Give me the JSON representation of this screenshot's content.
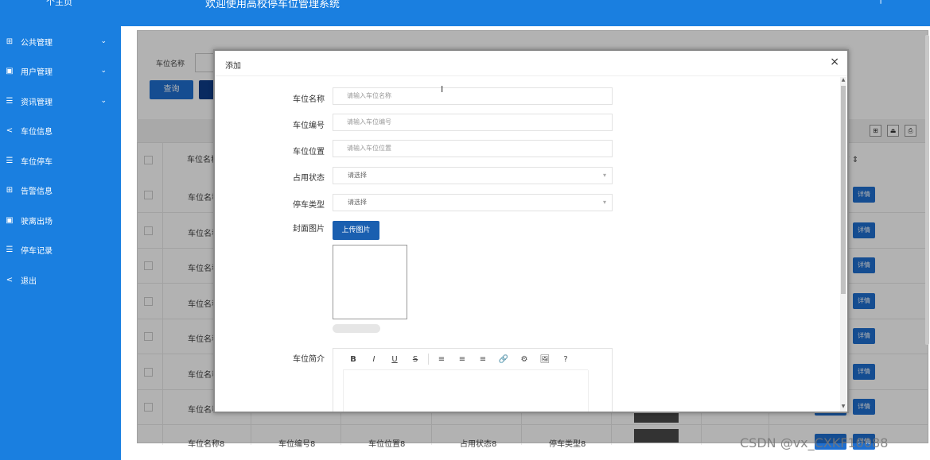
{
  "header": {
    "home_label": "个主页",
    "title": "欢迎使用高校停车位管理系统",
    "corner": "|"
  },
  "sidebar": {
    "items": [
      {
        "label": "公共管理",
        "icon": "grid-icon",
        "glyph": "⊞",
        "chevron": true
      },
      {
        "label": "用户管理",
        "icon": "doc-icon",
        "glyph": "▣",
        "chevron": true
      },
      {
        "label": "资讯管理",
        "icon": "list-icon",
        "glyph": "☰",
        "chevron": true
      },
      {
        "label": "车位信息",
        "icon": "share-icon",
        "glyph": "<",
        "chevron": false
      },
      {
        "label": "车位停车",
        "icon": "list-icon",
        "glyph": "☰",
        "chevron": false
      },
      {
        "label": "告警信息",
        "icon": "grid-icon",
        "glyph": "⊞",
        "chevron": false
      },
      {
        "label": "驶离出场",
        "icon": "doc-icon",
        "glyph": "▣",
        "chevron": false
      },
      {
        "label": "停车记录",
        "icon": "list-icon",
        "glyph": "☰",
        "chevron": false
      },
      {
        "label": "退出",
        "icon": "share-icon",
        "glyph": "<",
        "chevron": false
      }
    ],
    "chevron_glyph": "⌄"
  },
  "search": {
    "label": "车位名称",
    "query_button": "查询"
  },
  "table": {
    "column_name": "车位名称",
    "column_sort": "F ⇕",
    "rows": [
      {
        "name": "车位名称"
      },
      {
        "name": "车位名称"
      },
      {
        "name": "车位名称"
      },
      {
        "name": "车位名称"
      },
      {
        "name": "车位名称"
      },
      {
        "name": "车位名称"
      },
      {
        "name": "车位名称"
      }
    ],
    "detail_label": "详情",
    "last_row": {
      "name": "车位名称8",
      "code": "车位编号8",
      "location": "车位位置8",
      "status": "占用状态8",
      "type": "停车类型8"
    },
    "tool_icons": [
      "⊞",
      "⏏",
      "⎙"
    ]
  },
  "modal": {
    "title": "添加",
    "close": "×",
    "fields": [
      {
        "label": "车位名称",
        "placeholder": "请输入车位名称"
      },
      {
        "label": "车位编号",
        "placeholder": "请输入车位编号"
      },
      {
        "label": "车位位置",
        "placeholder": "请输入车位位置"
      }
    ],
    "selects": [
      {
        "label": "占用状态",
        "value": "请选择"
      },
      {
        "label": "停车类型",
        "value": "请选择"
      }
    ],
    "cover": {
      "label": "封面图片",
      "upload_button": "上传图片",
      "progress_fraction": 0
    },
    "intro": {
      "label": "车位简介",
      "toolbar": [
        "B",
        "I",
        "U",
        "S",
        "|",
        "≡",
        "≡",
        "≡",
        "🔗",
        "⚙",
        "🖼",
        "?"
      ]
    },
    "caret": "▾",
    "scroll_up": "▲",
    "scroll_down": "▼"
  },
  "cursor_glyph": "I",
  "watermark": "CSDN @vx_CXKF10088"
}
